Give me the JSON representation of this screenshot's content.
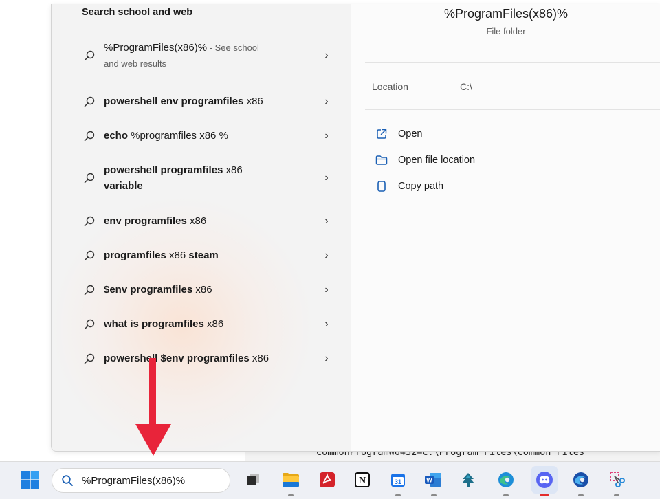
{
  "background": {
    "console_line": "CommonProgramW6432=C:\\Program Files\\Common Files"
  },
  "left_panel": {
    "section_title": "Search school and web",
    "results": [
      {
        "query_plain": "%ProgramFiles(x86)%",
        "query_bold": "",
        "suffix": " - See school",
        "second_line": "and web results"
      },
      {
        "query_bold": "powershell env programfiles",
        "query_plain": " x86"
      },
      {
        "query_bold": "echo",
        "query_plain": " %programfiles x86 %"
      },
      {
        "query_bold": "powershell programfiles",
        "query_plain": " x86",
        "second_line_bold": "variable"
      },
      {
        "query_bold": "env programfiles",
        "query_plain": " x86"
      },
      {
        "query_bold": "programfiles",
        "query_plain": " x86 ",
        "query_bold2": "steam"
      },
      {
        "query_bold": "$env programfiles",
        "query_plain": " x86"
      },
      {
        "query_bold": "what is programfiles",
        "query_plain": " x86"
      },
      {
        "query_bold": "powershell $env programfiles",
        "query_plain": " x86"
      }
    ]
  },
  "right_panel": {
    "title": "%ProgramFiles(x86)%",
    "subtitle": "File folder",
    "location_label": "Location",
    "location_value": "C:\\",
    "actions": [
      {
        "label": "Open",
        "icon": "open-external-icon"
      },
      {
        "label": "Open file location",
        "icon": "folder-icon"
      },
      {
        "label": "Copy path",
        "icon": "copy-icon"
      }
    ]
  },
  "taskbar": {
    "search_value": "%ProgramFiles(x86)%",
    "apps": [
      {
        "name": "task-view",
        "running": false
      },
      {
        "name": "file-explorer",
        "running": true
      },
      {
        "name": "adobe-acrobat",
        "running": false
      },
      {
        "name": "notion",
        "running": false
      },
      {
        "name": "calendar",
        "running": true,
        "label": "31"
      },
      {
        "name": "word",
        "running": true
      },
      {
        "name": "tree-app",
        "running": false
      },
      {
        "name": "edge",
        "running": true
      },
      {
        "name": "discord",
        "running": true,
        "active": true
      },
      {
        "name": "edge-beta",
        "running": true
      },
      {
        "name": "snipping-tool",
        "running": true
      }
    ]
  },
  "annotation": {
    "arrow_color": "#e8243a"
  }
}
